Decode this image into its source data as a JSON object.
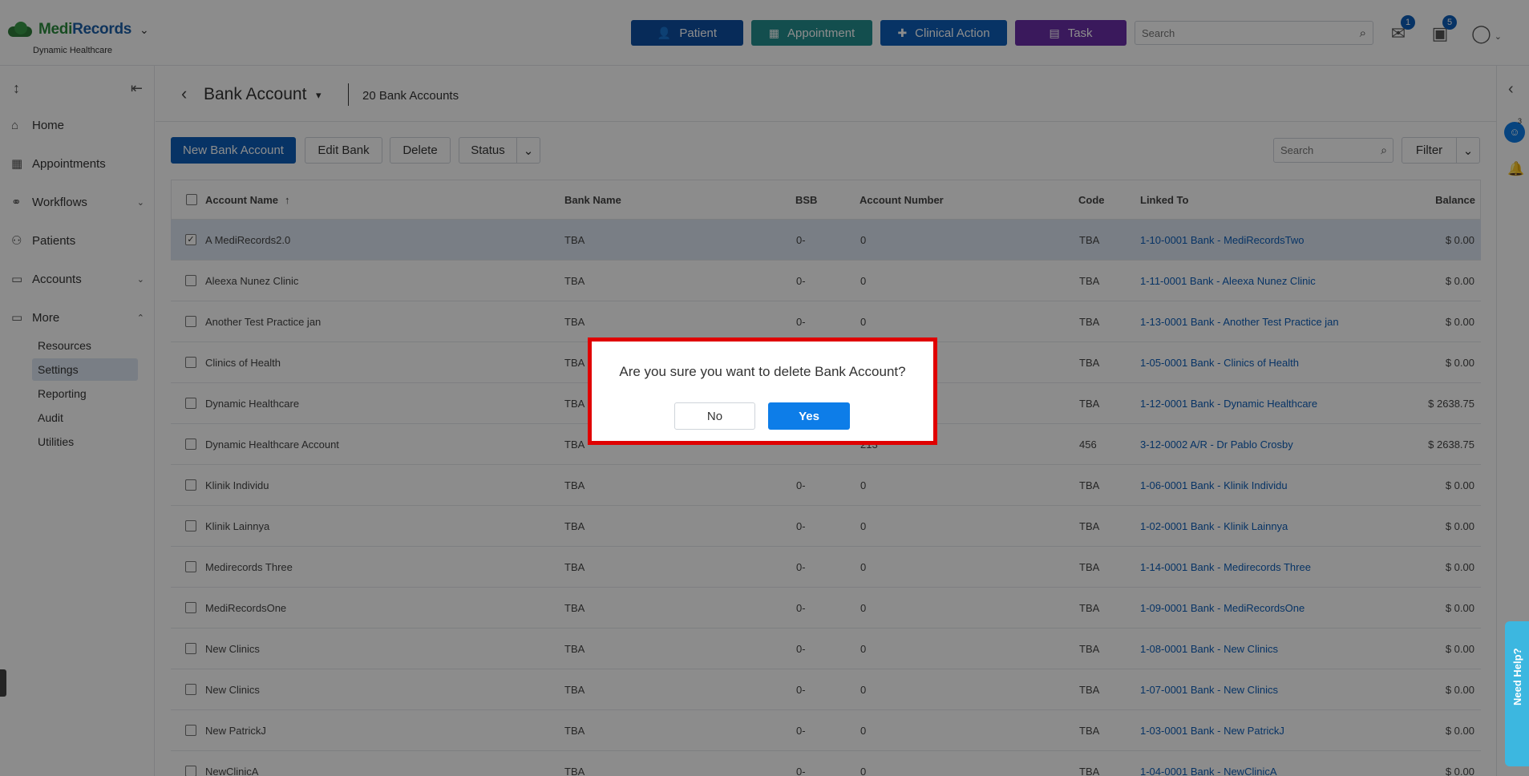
{
  "header": {
    "logo_text_a": "Medi",
    "logo_text_b": "Records",
    "org_name": "Dynamic Healthcare",
    "buttons": [
      {
        "label": "Patient",
        "icon": "user-plus-icon",
        "color": "#0d4fa3"
      },
      {
        "label": "Appointment",
        "icon": "calendar-icon",
        "color": "#238e8e"
      },
      {
        "label": "Clinical Action",
        "icon": "medkit-icon",
        "color": "#0d5eb8"
      },
      {
        "label": "Task",
        "icon": "clipboard-icon",
        "color": "#6a2fa8"
      }
    ],
    "search_placeholder": "Search",
    "messages_badge": "1",
    "tasks_badge": "5"
  },
  "sidebar": {
    "items": [
      {
        "label": "Home",
        "icon": "home-icon"
      },
      {
        "label": "Appointments",
        "icon": "calendar-icon"
      },
      {
        "label": "Workflows",
        "icon": "workflow-icon"
      },
      {
        "label": "Patients",
        "icon": "users-icon"
      },
      {
        "label": "Accounts",
        "icon": "folder-icon"
      },
      {
        "label": "More",
        "icon": "folder-open-icon"
      }
    ],
    "sub_items": [
      "Resources",
      "Settings",
      "Reporting",
      "Audit",
      "Utilities"
    ],
    "active_sub": "Settings"
  },
  "page": {
    "title": "Bank Account",
    "count": "20 Bank Accounts"
  },
  "toolbar": {
    "new": "New Bank Account",
    "edit": "Edit Bank",
    "delete": "Delete",
    "status": "Status",
    "search_placeholder": "Search",
    "filter": "Filter"
  },
  "table": {
    "headers": [
      "Account Name",
      "Bank Name",
      "BSB",
      "Account Number",
      "Code",
      "Linked To",
      "Balance"
    ],
    "rows": [
      {
        "name": "A MediRecords2.0",
        "bank": "TBA",
        "bsb": "0-",
        "acct": "0",
        "code": "TBA",
        "linked": "1-10-0001 Bank - MediRecordsTwo",
        "balance": "$ 0.00",
        "selected": true
      },
      {
        "name": "Aleexa Nunez Clinic",
        "bank": "TBA",
        "bsb": "0-",
        "acct": "0",
        "code": "TBA",
        "linked": "1-11-0001 Bank - Aleexa Nunez Clinic",
        "balance": "$ 0.00"
      },
      {
        "name": "Another Test Practice jan",
        "bank": "TBA",
        "bsb": "0-",
        "acct": "0",
        "code": "TBA",
        "linked": "1-13-0001 Bank - Another Test Practice jan",
        "balance": "$ 0.00"
      },
      {
        "name": "Clinics of Health",
        "bank": "TBA",
        "bsb": "",
        "acct": "",
        "code": "TBA",
        "linked": "1-05-0001 Bank - Clinics of Health",
        "balance": "$ 0.00"
      },
      {
        "name": "Dynamic Healthcare",
        "bank": "TBA",
        "bsb": "",
        "acct": "",
        "code": "TBA",
        "linked": "1-12-0001 Bank - Dynamic Healthcare",
        "balance": "$ 2638.75"
      },
      {
        "name": "Dynamic Healthcare Account",
        "bank": "TBA",
        "bsb": "",
        "acct": "213",
        "code": "456",
        "linked": "3-12-0002 A/R - Dr Pablo Crosby",
        "balance": "$ 2638.75"
      },
      {
        "name": "Klinik Individu",
        "bank": "TBA",
        "bsb": "0-",
        "acct": "0",
        "code": "TBA",
        "linked": "1-06-0001 Bank - Klinik Individu",
        "balance": "$ 0.00"
      },
      {
        "name": "Klinik Lainnya",
        "bank": "TBA",
        "bsb": "0-",
        "acct": "0",
        "code": "TBA",
        "linked": "1-02-0001 Bank - Klinik Lainnya",
        "balance": "$ 0.00"
      },
      {
        "name": "Medirecords Three",
        "bank": "TBA",
        "bsb": "0-",
        "acct": "0",
        "code": "TBA",
        "linked": "1-14-0001 Bank - Medirecords Three",
        "balance": "$ 0.00"
      },
      {
        "name": "MediRecordsOne",
        "bank": "TBA",
        "bsb": "0-",
        "acct": "0",
        "code": "TBA",
        "linked": "1-09-0001 Bank - MediRecordsOne",
        "balance": "$ 0.00"
      },
      {
        "name": "New Clinics",
        "bank": "TBA",
        "bsb": "0-",
        "acct": "0",
        "code": "TBA",
        "linked": "1-08-0001 Bank - New Clinics",
        "balance": "$ 0.00"
      },
      {
        "name": "New Clinics",
        "bank": "TBA",
        "bsb": "0-",
        "acct": "0",
        "code": "TBA",
        "linked": "1-07-0001 Bank - New Clinics",
        "balance": "$ 0.00"
      },
      {
        "name": "New PatrickJ",
        "bank": "TBA",
        "bsb": "0-",
        "acct": "0",
        "code": "TBA",
        "linked": "1-03-0001 Bank - New PatrickJ",
        "balance": "$ 0.00"
      },
      {
        "name": "NewClinicA",
        "bank": "TBA",
        "bsb": "0-",
        "acct": "0",
        "code": "TBA",
        "linked": "1-04-0001 Bank - NewClinicA",
        "balance": "$ 0.00"
      }
    ]
  },
  "dialog": {
    "message": "Are you sure you want to delete Bank Account?",
    "no": "No",
    "yes": "Yes"
  },
  "help_tab": "Need Help?",
  "right_chat_badge": "3"
}
